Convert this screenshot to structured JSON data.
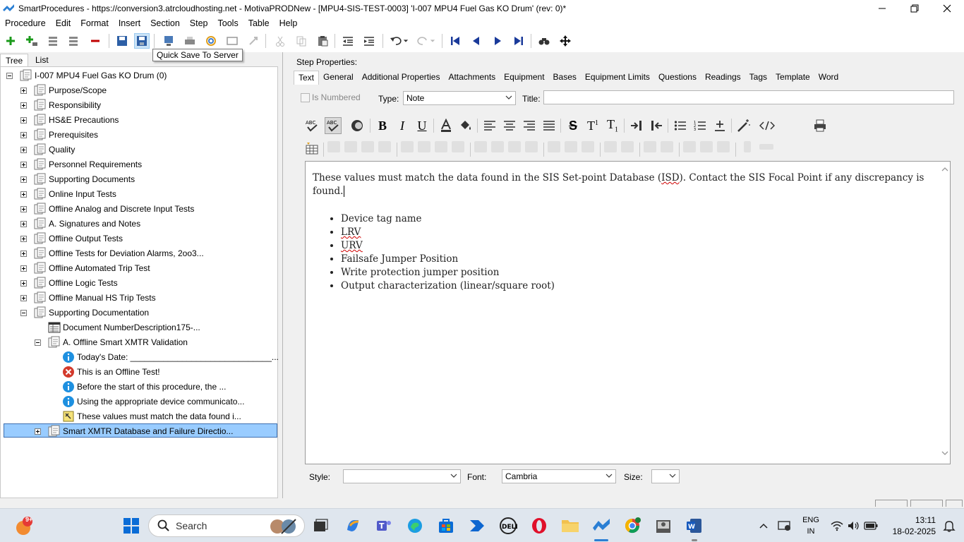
{
  "window": {
    "title": "SmartProcedures - https://conversion3.atrcloudhosting.net - MotivaPRODNew - [MPU4-SIS-TEST-0003] 'I-007 MPU4 Fuel Gas KO Drum' (rev: 0)*"
  },
  "menu": [
    "Procedure",
    "Edit",
    "Format",
    "Insert",
    "Section",
    "Step",
    "Tools",
    "Table",
    "Help"
  ],
  "toolbar": {
    "tooltip": "Quick Save To Server"
  },
  "left_tabs": [
    "Tree",
    "List"
  ],
  "tree": {
    "root": "I-007 MPU4 Fuel Gas KO Drum (0)",
    "sections": [
      "Purpose/Scope",
      "Responsibility",
      "HS&E Precautions",
      "Prerequisites",
      "Quality",
      "Personnel Requirements",
      "Supporting Documents",
      "Online Input Tests",
      "Offline Analog and Discrete Input Tests",
      "A. Signatures and Notes",
      "Offline Output Tests",
      "Offline Tests for Deviation Alarms, 2oo3...",
      "Offline Automated Trip Test",
      "Offline Logic Tests",
      "Offline Manual HS Trip Tests",
      "Supporting Documentation"
    ],
    "doc_number": "Document NumberDescription175-...",
    "subsection": "A. Offline Smart XMTR Validation",
    "steps": [
      "Today's Date: ______________________________...",
      "This is an Offline Test!",
      "Before the start of this procedure, the ...",
      "Using the appropriate device communicato...",
      "These values must match the data found i..."
    ],
    "last_section": "Smart XMTR Database and Failure Directio..."
  },
  "step_properties": {
    "label": "Step Properties:",
    "tabs": [
      "Text",
      "General",
      "Additional Properties",
      "Attachments",
      "Equipment",
      "Bases",
      "Equipment Limits",
      "Questions",
      "Readings",
      "Tags",
      "Template",
      "Word"
    ],
    "is_numbered": "Is Numbered",
    "type_label": "Type:",
    "type_value": "Note",
    "title_label": "Title:",
    "title_value": ""
  },
  "editor": {
    "paragraph_line1": "These values must match the data found in the SIS Set-point Database (",
    "paragraph_isd": "ISD",
    "paragraph_line2": "). Contact the SIS Focal Point if any discrepancy is found.",
    "bullets": [
      "Device tag name",
      "LRV",
      "URV",
      "Failsafe Jumper Position",
      "Write protection jumper position",
      "Output characterization (linear/square root)"
    ]
  },
  "bottom": {
    "style_label": "Style:",
    "style_value": "",
    "font_label": "Font:",
    "font_value": "Cambria",
    "size_label": "Size:",
    "size_value": ""
  },
  "taskbar": {
    "search_placeholder": "Search",
    "notification_badge": "9+",
    "lang_line1": "ENG",
    "lang_line2": "IN",
    "time": "13:11",
    "date": "18-02-2025"
  },
  "colors": {
    "selection": "#99ccff",
    "info_icon": "#1e90e0",
    "error_icon": "#d33a2c",
    "taskbar": "#dfe6ee"
  }
}
